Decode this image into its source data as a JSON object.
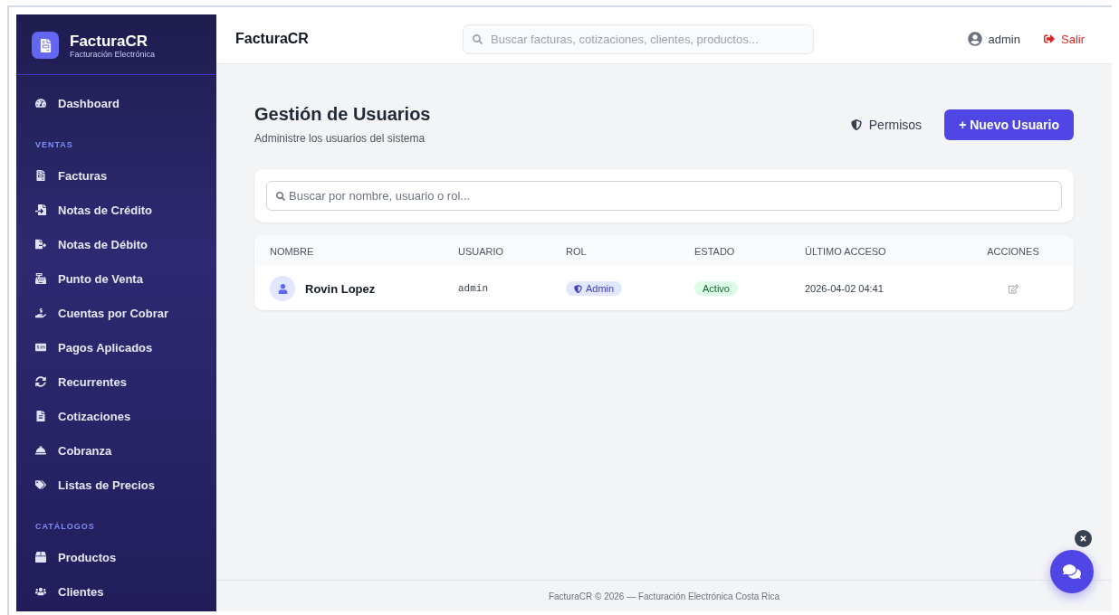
{
  "brand": {
    "name": "FacturaCR",
    "subtitle": "Facturación Electrónica"
  },
  "sidebar": {
    "sections": [
      {
        "items": [
          {
            "label": "Dashboard",
            "selected": false
          }
        ]
      },
      {
        "heading": "VENTAS",
        "items": [
          {
            "label": "Facturas",
            "selected": false
          },
          {
            "label": "Notas de Crédito",
            "selected": false
          },
          {
            "label": "Notas de Débito",
            "selected": false
          },
          {
            "label": "Punto de Venta",
            "selected": false
          },
          {
            "label": "Cuentas por Cobrar",
            "selected": false
          },
          {
            "label": "Pagos Aplicados",
            "selected": false
          },
          {
            "label": "Recurrentes",
            "selected": false
          },
          {
            "label": "Cotizaciones",
            "selected": false
          },
          {
            "label": "Cobranza",
            "selected": false
          },
          {
            "label": "Listas de Precios",
            "selected": false
          }
        ]
      },
      {
        "heading": "CATÁLOGOS",
        "items": [
          {
            "label": "Productos",
            "selected": false
          },
          {
            "label": "Clientes",
            "selected": false
          }
        ]
      }
    ]
  },
  "topbar": {
    "title": "FacturaCR",
    "search": {
      "placeholder": "Buscar facturas, cotizaciones, clientes, productos..."
    },
    "user": "admin",
    "logout": "Salir"
  },
  "page": {
    "title": "Gestión de Usuarios",
    "subtitle": "Administre los usuarios del sistema",
    "buttons": {
      "permissions": "Permisos",
      "new_user": "+ Nuevo Usuario"
    }
  },
  "filter": {
    "placeholder": "Buscar por nombre, usuario o rol..."
  },
  "table": {
    "columns": [
      "NOMBRE",
      "USUARIO",
      "ROL",
      "ESTADO",
      "ÚLTIMO ACCESO",
      "ACCIONES"
    ],
    "rows": [
      {
        "name": "Rovin Lopez",
        "username": "admin",
        "role": "Admin",
        "status": "Activo",
        "active": true,
        "last_access": "2026-04-02 04:41"
      }
    ]
  },
  "footer": "FacturaCR © 2026 — Facturación Electrónica Costa Rica"
}
